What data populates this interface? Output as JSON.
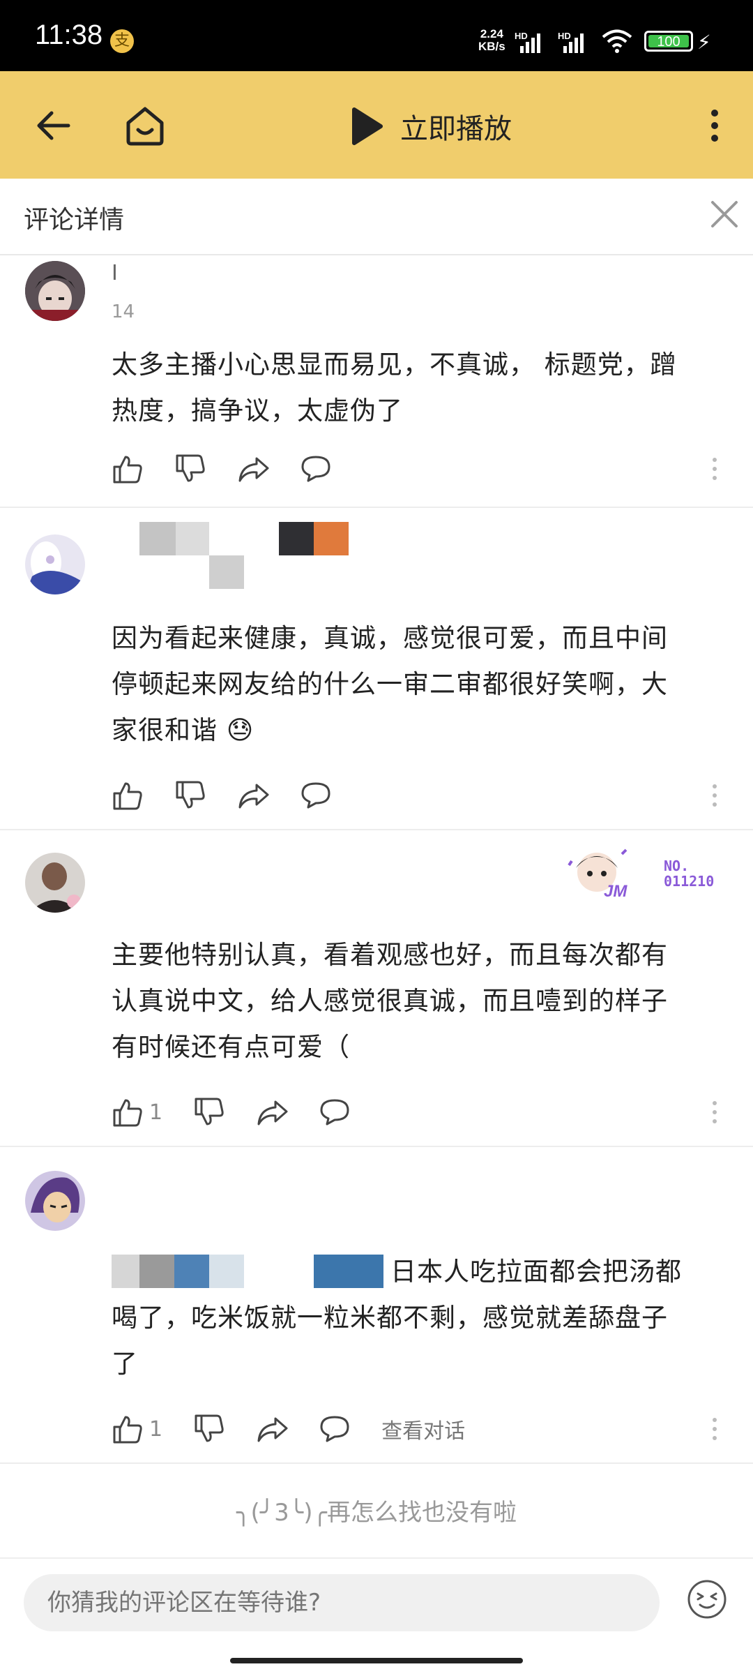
{
  "status_bar": {
    "time": "11:38",
    "app_icon": "支",
    "speed_value": "2.24",
    "speed_unit": "KB/s",
    "sim1": "HD",
    "sim2": "HD",
    "battery": "100"
  },
  "appbar": {
    "play_label": "立即播放",
    "icons": [
      "back-arrow-icon",
      "home-icon",
      "play-icon",
      "more-vertical-icon"
    ]
  },
  "detail": {
    "title": "评论详情"
  },
  "comments": [
    {
      "username": "I",
      "time": "14",
      "text_lines": [
        "太多主播小心思显而易见，不真诚， 标题党，蹭",
        "热度，搞争议，太虚伪了"
      ],
      "likes": ""
    },
    {
      "username": "",
      "time": "",
      "text_lines": [
        "因为看起来健康，真诚，感觉很可爱，而且中间",
        "停顿起来网友给的什么一审二审都很好笑啊，大",
        "家很和谐"
      ],
      "emoji": "😓",
      "likes": ""
    },
    {
      "username": "",
      "time": "",
      "badge_text": "JM",
      "badge_no_line1": "NO.",
      "badge_no_line2": "011210",
      "text_lines": [
        "主要他特别认真，看着观感也好，而且每次都有",
        "认真说中文，给人感觉很真诚，而且噎到的样子",
        "有时候还有点可爱（"
      ],
      "likes": "1"
    },
    {
      "username": "",
      "time": "",
      "text_lines": [
        "日本人吃拉面都会把汤都",
        "喝了，吃米饭就一粒米都不剩，感觉就差舔盘子",
        "了"
      ],
      "likes": "1",
      "view_conversation": "查看对话"
    }
  ],
  "footer_note": "╮(╯3╰)╭再怎么找也没有啦",
  "input": {
    "placeholder": "你猜我的评论区在等待谁?"
  }
}
